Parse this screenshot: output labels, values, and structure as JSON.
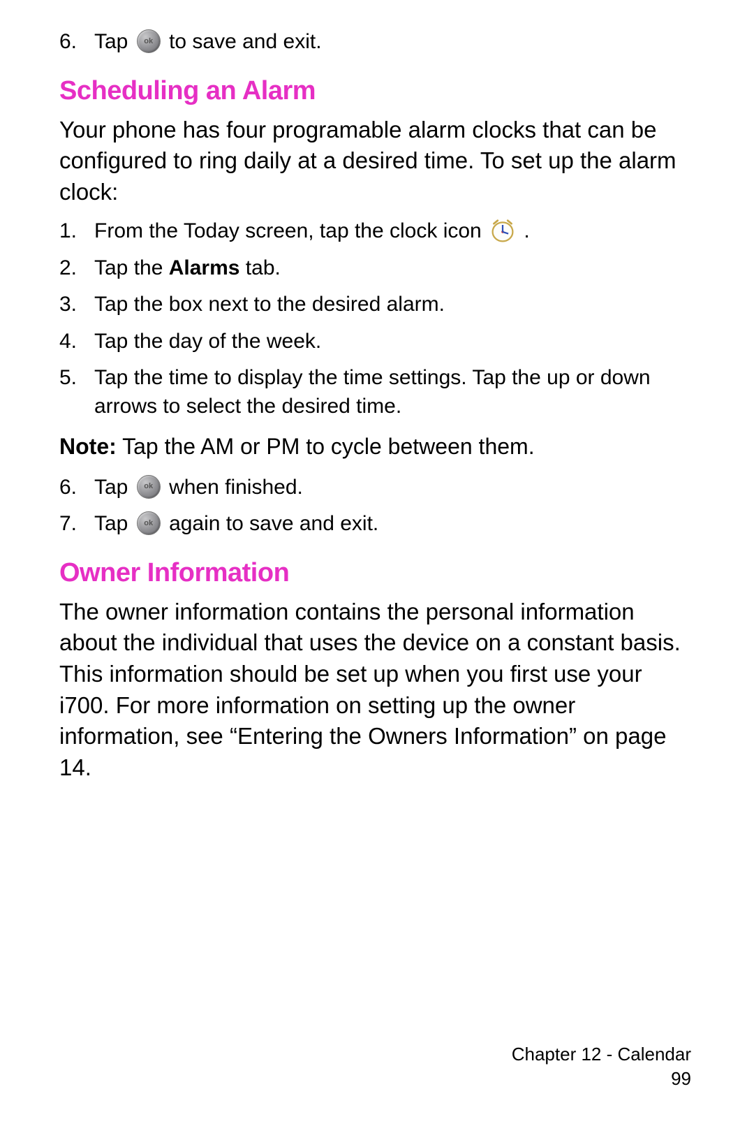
{
  "top_step": {
    "num": "6.",
    "pre": "Tap ",
    "post": " to save and exit."
  },
  "section1": {
    "heading": "Scheduling an Alarm",
    "intro": "Your phone has four programable alarm clocks that can be configured to ring daily at a desired time. To set up the alarm clock:",
    "steps": [
      {
        "num": "1.",
        "pre": "From the Today screen, tap the clock icon ",
        "post": "."
      },
      {
        "num": "2.",
        "pre": "Tap the ",
        "bold": "Alarms",
        "post": " tab."
      },
      {
        "num": "3.",
        "text": "Tap the box next to the desired alarm."
      },
      {
        "num": "4.",
        "text": "Tap the day of the week."
      },
      {
        "num": "5.",
        "text": "Tap the time to display the time settings. Tap the up or down arrows to select the desired time."
      }
    ],
    "note": {
      "label": "Note:",
      "text": " Tap the AM or PM to cycle between them."
    },
    "steps2": [
      {
        "num": "6.",
        "pre": "Tap ",
        "post": " when finished."
      },
      {
        "num": "7.",
        "pre": "Tap ",
        "post": " again to save and exit."
      }
    ]
  },
  "section2": {
    "heading": "Owner Information",
    "body": "The owner information contains the personal information about the individual that uses the device on a constant basis. This information should be set up when you first use your i700. For more information on setting up the owner information, see “Entering the Owners Information” on page 14."
  },
  "footer": {
    "chapter": "Chapter 12 - Calendar",
    "page": "99"
  },
  "icons": {
    "ok": "ok"
  }
}
